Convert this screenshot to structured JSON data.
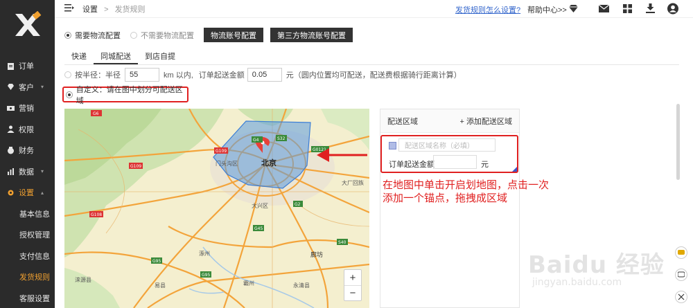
{
  "sidebar": {
    "items": [
      {
        "label": "订单",
        "icon": "clipboard-icon"
      },
      {
        "label": "客户",
        "icon": "diamond-icon",
        "caret": "▾"
      },
      {
        "label": "营销",
        "icon": "ticket-icon"
      },
      {
        "label": "权限",
        "icon": "user-icon"
      },
      {
        "label": "财务",
        "icon": "wallet-icon"
      },
      {
        "label": "数据",
        "icon": "bar-chart-icon",
        "caret": "▾"
      },
      {
        "label": "设置",
        "icon": "gear-icon",
        "caret": "▴"
      }
    ],
    "sub_items": [
      {
        "label": "基本信息"
      },
      {
        "label": "授权管理"
      },
      {
        "label": "支付信息"
      },
      {
        "label": "发货规则"
      },
      {
        "label": "客服设置"
      }
    ]
  },
  "topbar": {
    "breadcrumb_root": "设置",
    "breadcrumb_sep": ">",
    "breadcrumb_current": "发货规则",
    "help_link": "发货规则怎么设置?",
    "help_center": "帮助中心>>"
  },
  "logistics": {
    "option_need": "需要物流配置",
    "option_no_need": "不需要物流配置",
    "btn_account": "物流账号配置",
    "btn_third_party": "第三方物流账号配置"
  },
  "tabs": [
    {
      "label": "快递"
    },
    {
      "label": "同城配送"
    },
    {
      "label": "到店自提"
    }
  ],
  "radius_rule": {
    "label": "按半径：半径",
    "radius_value": "55",
    "unit_text": "km 以内,",
    "min_order_label": "订单起送金额",
    "min_order_value": "0.05",
    "note": "元（圆内位置均可配送，配送费根据骑行距离计算）"
  },
  "custom_rule": {
    "label": "自定义：请在图中划分可配送区域"
  },
  "map": {
    "city_label": "北京",
    "places": [
      "廊坊",
      "涿州",
      "大兴区",
      "门头沟区",
      "大厂回族"
    ],
    "road_labels": [
      "G6",
      "G110",
      "G109",
      "G108",
      "G95",
      "G4",
      "G45",
      "G2",
      "G1",
      "G3",
      "S32",
      "G45",
      "S40",
      "G0121",
      "G103",
      "G102",
      "G112",
      "S15",
      "S99"
    ],
    "zoom_in": "+",
    "zoom_out": "−",
    "pin_color": "#e8403a",
    "polygon_color": "#5b9be0"
  },
  "delivery_panel": {
    "title": "配送区域",
    "add_label": "+ 添加配送区域",
    "zone_name_placeholder": "配送区域名称（必填）",
    "zone_fee_label": "订单起送金额",
    "zone_fee_unit": "元"
  },
  "annotation": {
    "line1": "在地图中单击开启划地图，点击一次",
    "line2": "添加一个锚点，拖拽成区域"
  },
  "watermark": {
    "text": "Baidu 经验",
    "url": "jingyan.baidu.com"
  },
  "colors": {
    "sidebar_bg": "#2b2b2b",
    "accent": "#f0a030",
    "highlight_red": "#e02020",
    "link_blue": "#3366cc"
  }
}
